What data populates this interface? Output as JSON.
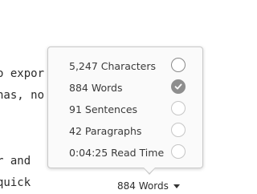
{
  "editor": {
    "lines": [
      "o expor",
      "has, no",
      "r and",
      "quick"
    ]
  },
  "stats_popover": {
    "items": [
      {
        "label": "5,247 Characters",
        "selected": false
      },
      {
        "label": "884 Words",
        "selected": true
      },
      {
        "label": "91 Sentences",
        "selected": false
      },
      {
        "label": "42 Paragraphs",
        "selected": false
      },
      {
        "label": "0:04:25 Read Time",
        "selected": false
      }
    ]
  },
  "status_bar": {
    "word_count_label": "884 Words"
  }
}
